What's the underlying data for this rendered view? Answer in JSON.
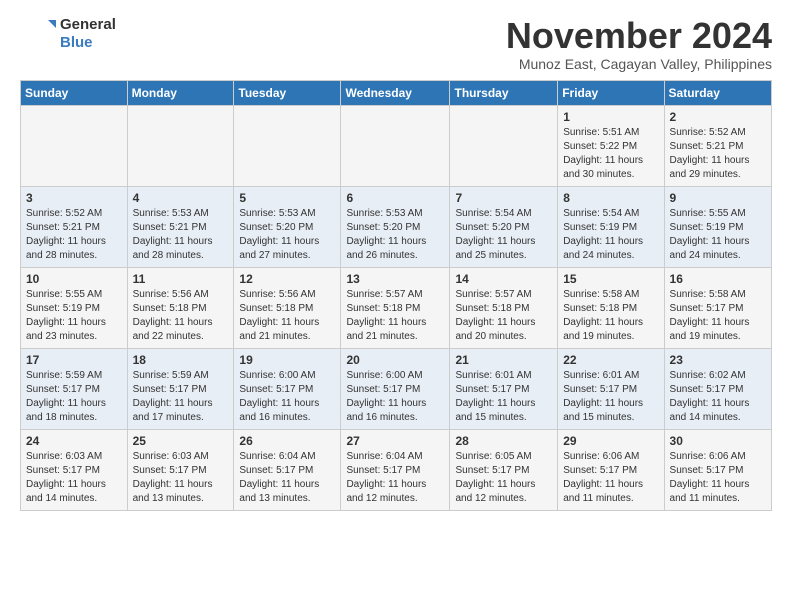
{
  "header": {
    "logo_general": "General",
    "logo_blue": "Blue",
    "month_title": "November 2024",
    "location": "Munoz East, Cagayan Valley, Philippines"
  },
  "calendar": {
    "days_of_week": [
      "Sunday",
      "Monday",
      "Tuesday",
      "Wednesday",
      "Thursday",
      "Friday",
      "Saturday"
    ],
    "weeks": [
      [
        {
          "day": "",
          "info": ""
        },
        {
          "day": "",
          "info": ""
        },
        {
          "day": "",
          "info": ""
        },
        {
          "day": "",
          "info": ""
        },
        {
          "day": "",
          "info": ""
        },
        {
          "day": "1",
          "info": "Sunrise: 5:51 AM\nSunset: 5:22 PM\nDaylight: 11 hours and 30 minutes."
        },
        {
          "day": "2",
          "info": "Sunrise: 5:52 AM\nSunset: 5:21 PM\nDaylight: 11 hours and 29 minutes."
        }
      ],
      [
        {
          "day": "3",
          "info": "Sunrise: 5:52 AM\nSunset: 5:21 PM\nDaylight: 11 hours and 28 minutes."
        },
        {
          "day": "4",
          "info": "Sunrise: 5:53 AM\nSunset: 5:21 PM\nDaylight: 11 hours and 28 minutes."
        },
        {
          "day": "5",
          "info": "Sunrise: 5:53 AM\nSunset: 5:20 PM\nDaylight: 11 hours and 27 minutes."
        },
        {
          "day": "6",
          "info": "Sunrise: 5:53 AM\nSunset: 5:20 PM\nDaylight: 11 hours and 26 minutes."
        },
        {
          "day": "7",
          "info": "Sunrise: 5:54 AM\nSunset: 5:20 PM\nDaylight: 11 hours and 25 minutes."
        },
        {
          "day": "8",
          "info": "Sunrise: 5:54 AM\nSunset: 5:19 PM\nDaylight: 11 hours and 24 minutes."
        },
        {
          "day": "9",
          "info": "Sunrise: 5:55 AM\nSunset: 5:19 PM\nDaylight: 11 hours and 24 minutes."
        }
      ],
      [
        {
          "day": "10",
          "info": "Sunrise: 5:55 AM\nSunset: 5:19 PM\nDaylight: 11 hours and 23 minutes."
        },
        {
          "day": "11",
          "info": "Sunrise: 5:56 AM\nSunset: 5:18 PM\nDaylight: 11 hours and 22 minutes."
        },
        {
          "day": "12",
          "info": "Sunrise: 5:56 AM\nSunset: 5:18 PM\nDaylight: 11 hours and 21 minutes."
        },
        {
          "day": "13",
          "info": "Sunrise: 5:57 AM\nSunset: 5:18 PM\nDaylight: 11 hours and 21 minutes."
        },
        {
          "day": "14",
          "info": "Sunrise: 5:57 AM\nSunset: 5:18 PM\nDaylight: 11 hours and 20 minutes."
        },
        {
          "day": "15",
          "info": "Sunrise: 5:58 AM\nSunset: 5:18 PM\nDaylight: 11 hours and 19 minutes."
        },
        {
          "day": "16",
          "info": "Sunrise: 5:58 AM\nSunset: 5:17 PM\nDaylight: 11 hours and 19 minutes."
        }
      ],
      [
        {
          "day": "17",
          "info": "Sunrise: 5:59 AM\nSunset: 5:17 PM\nDaylight: 11 hours and 18 minutes."
        },
        {
          "day": "18",
          "info": "Sunrise: 5:59 AM\nSunset: 5:17 PM\nDaylight: 11 hours and 17 minutes."
        },
        {
          "day": "19",
          "info": "Sunrise: 6:00 AM\nSunset: 5:17 PM\nDaylight: 11 hours and 16 minutes."
        },
        {
          "day": "20",
          "info": "Sunrise: 6:00 AM\nSunset: 5:17 PM\nDaylight: 11 hours and 16 minutes."
        },
        {
          "day": "21",
          "info": "Sunrise: 6:01 AM\nSunset: 5:17 PM\nDaylight: 11 hours and 15 minutes."
        },
        {
          "day": "22",
          "info": "Sunrise: 6:01 AM\nSunset: 5:17 PM\nDaylight: 11 hours and 15 minutes."
        },
        {
          "day": "23",
          "info": "Sunrise: 6:02 AM\nSunset: 5:17 PM\nDaylight: 11 hours and 14 minutes."
        }
      ],
      [
        {
          "day": "24",
          "info": "Sunrise: 6:03 AM\nSunset: 5:17 PM\nDaylight: 11 hours and 14 minutes."
        },
        {
          "day": "25",
          "info": "Sunrise: 6:03 AM\nSunset: 5:17 PM\nDaylight: 11 hours and 13 minutes."
        },
        {
          "day": "26",
          "info": "Sunrise: 6:04 AM\nSunset: 5:17 PM\nDaylight: 11 hours and 13 minutes."
        },
        {
          "day": "27",
          "info": "Sunrise: 6:04 AM\nSunset: 5:17 PM\nDaylight: 11 hours and 12 minutes."
        },
        {
          "day": "28",
          "info": "Sunrise: 6:05 AM\nSunset: 5:17 PM\nDaylight: 11 hours and 12 minutes."
        },
        {
          "day": "29",
          "info": "Sunrise: 6:06 AM\nSunset: 5:17 PM\nDaylight: 11 hours and 11 minutes."
        },
        {
          "day": "30",
          "info": "Sunrise: 6:06 AM\nSunset: 5:17 PM\nDaylight: 11 hours and 11 minutes."
        }
      ]
    ]
  }
}
